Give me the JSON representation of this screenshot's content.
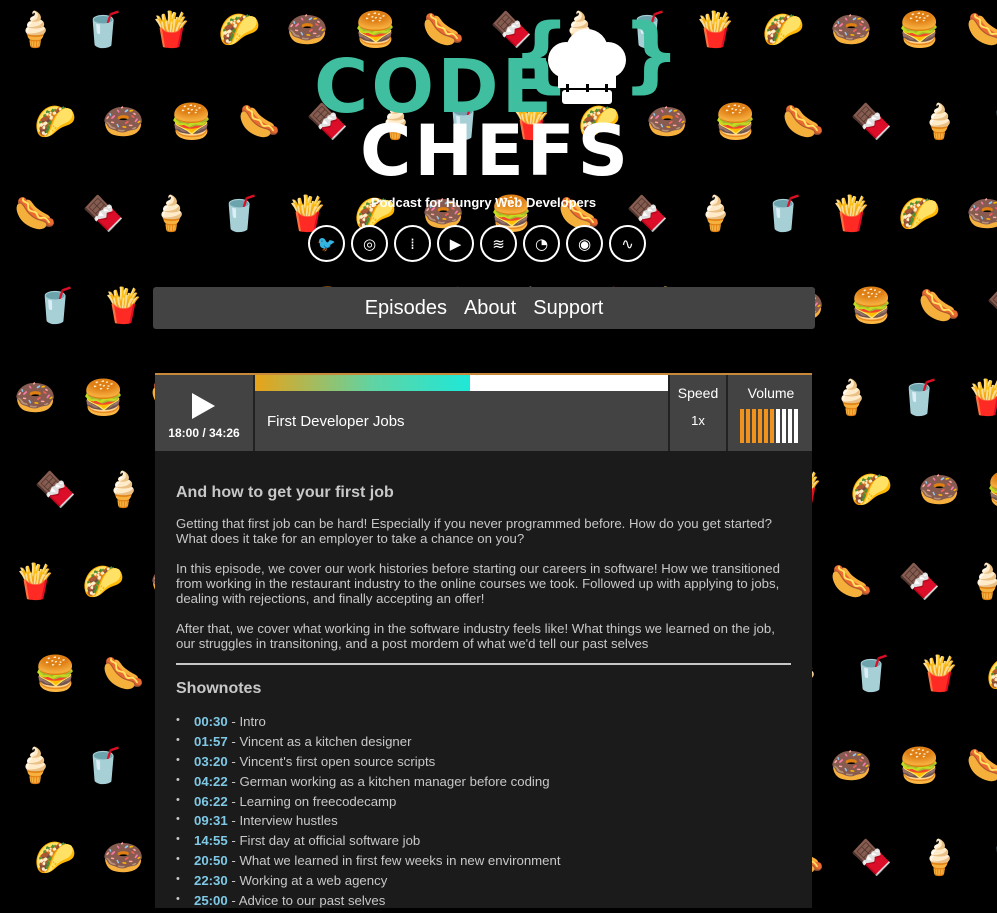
{
  "brand": {
    "line1": "CODE",
    "line2": "CHEFS",
    "tagline": "Podcast for Hungry Web Developers",
    "accent": "#3fbf9f"
  },
  "socials": [
    {
      "icon": "twitter-icon",
      "glyph": "🐦"
    },
    {
      "icon": "apple-podcasts-icon",
      "glyph": "◎"
    },
    {
      "icon": "google-podcasts-icon",
      "glyph": "⁞"
    },
    {
      "icon": "google-play-icon",
      "glyph": "▶"
    },
    {
      "icon": "spotify-icon",
      "glyph": "≋"
    },
    {
      "icon": "pocket-casts-icon",
      "glyph": "◔"
    },
    {
      "icon": "overcast-icon",
      "glyph": "◉"
    },
    {
      "icon": "rss-icon",
      "glyph": "∿"
    }
  ],
  "nav": {
    "episodes": "Episodes",
    "about": "About",
    "support": "Support"
  },
  "player": {
    "time": "18:00 / 34:26",
    "episode_title": "First Developer Jobs",
    "speed_label": "Speed",
    "speed_value": "1x",
    "volume_label": "Volume",
    "progress": 0.52,
    "volume_level": 0.6
  },
  "episode": {
    "subtitle": "And how to get your first job",
    "paragraphs": [
      "Getting that first job can be hard! Especially if you never programmed before. How do you get started? What does it take for an employer to take a chance on you?",
      "In this episode, we cover our work histories before starting our careers in software! How we transitioned from working in the restaurant industry to the online courses we took. Followed up with applying to jobs, dealing with rejections, and finally accepting an offer!",
      "After that, we cover what working in the software industry feels like! What things we learned on the job, our struggles in transitoning, and a post mordem of what we'd tell our past selves"
    ],
    "shownotes_title": "Shownotes",
    "shownotes": [
      {
        "time": "00:30",
        "text": " - Intro"
      },
      {
        "time": "01:57",
        "text": " - Vincent as a kitchen designer"
      },
      {
        "time": "03:20",
        "text": " - Vincent's first open source scripts"
      },
      {
        "time": "04:22",
        "text": " - German working as a kitchen manager before coding"
      },
      {
        "time": "06:22",
        "text": " - Learning on freecodecamp"
      },
      {
        "time": "09:31",
        "text": " - Interview hustles"
      },
      {
        "time": "14:55",
        "text": " - First day at official software job"
      },
      {
        "time": "20:50",
        "text": " - What we learned in first few weeks in new environment"
      },
      {
        "time": "22:30",
        "text": " - Working at a web agency"
      },
      {
        "time": "25:00",
        "text": " - Advice to our past selves"
      }
    ]
  }
}
